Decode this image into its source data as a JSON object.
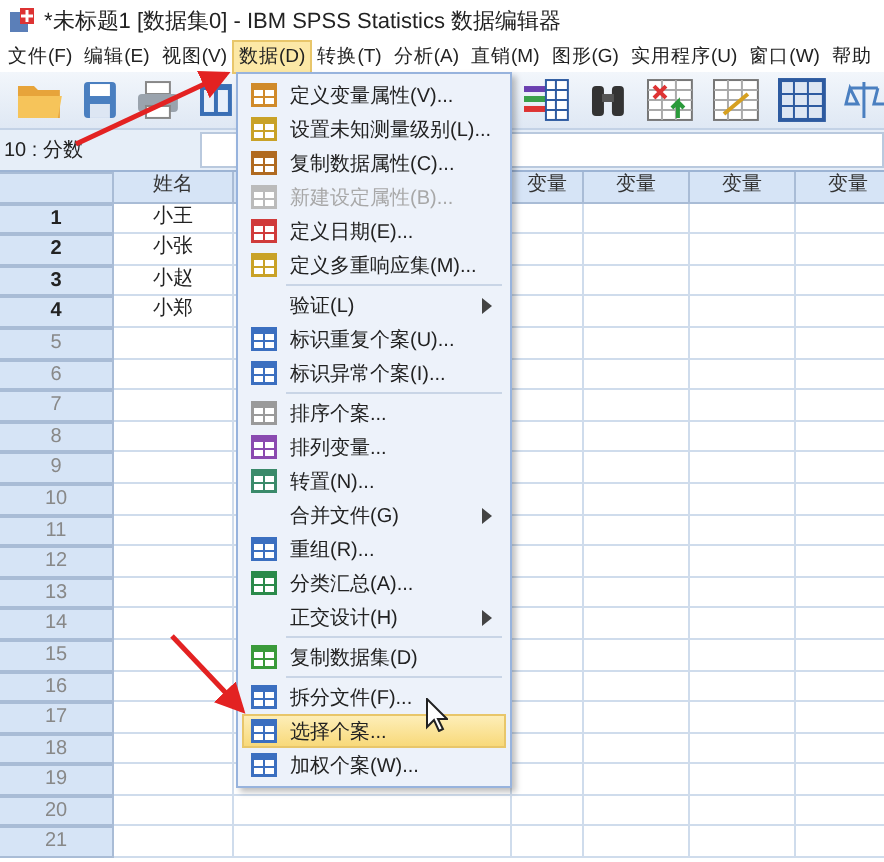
{
  "window": {
    "title": "*未标题1 [数据集0] - IBM SPSS Statistics 数据编辑器"
  },
  "menubar": [
    {
      "label": "文件(F)",
      "selected": false
    },
    {
      "label": "编辑(E)",
      "selected": false
    },
    {
      "label": "视图(V)",
      "selected": false
    },
    {
      "label": "数据(D)",
      "selected": true
    },
    {
      "label": "转换(T)",
      "selected": false
    },
    {
      "label": "分析(A)",
      "selected": false
    },
    {
      "label": "直销(M)",
      "selected": false
    },
    {
      "label": "图形(G)",
      "selected": false
    },
    {
      "label": "实用程序(U)",
      "selected": false
    },
    {
      "label": "窗口(W)",
      "selected": false
    },
    {
      "label": "帮助",
      "selected": false
    }
  ],
  "cell_reference": "10 : 分数",
  "grid": {
    "columns": [
      "姓名",
      "变量",
      "变量",
      "变量",
      "变量"
    ],
    "rows": [
      {
        "number": "1",
        "name": "小王"
      },
      {
        "number": "2",
        "name": "小张"
      },
      {
        "number": "3",
        "name": "小赵"
      },
      {
        "number": "4",
        "name": "小郑"
      },
      {
        "number": "5"
      },
      {
        "number": "6"
      },
      {
        "number": "7"
      },
      {
        "number": "8"
      },
      {
        "number": "9"
      },
      {
        "number": "10"
      },
      {
        "number": "11"
      },
      {
        "number": "12"
      },
      {
        "number": "13"
      },
      {
        "number": "14"
      },
      {
        "number": "15"
      },
      {
        "number": "16"
      },
      {
        "number": "17"
      },
      {
        "number": "18"
      },
      {
        "number": "19"
      },
      {
        "number": "20"
      },
      {
        "number": "21"
      }
    ]
  },
  "data_menu": [
    {
      "kind": "item",
      "label": "定义变量属性(V)...",
      "disabled": false,
      "selected": false
    },
    {
      "kind": "item",
      "label": "设置未知测量级别(L)...",
      "disabled": false,
      "selected": false
    },
    {
      "kind": "item",
      "label": "复制数据属性(C)...",
      "disabled": false,
      "selected": false
    },
    {
      "kind": "item",
      "label": "新建设定属性(B)...",
      "disabled": true,
      "selected": false
    },
    {
      "kind": "item",
      "label": "定义日期(E)...",
      "disabled": false,
      "selected": false
    },
    {
      "kind": "item",
      "label": "定义多重响应集(M)...",
      "disabled": false,
      "selected": false
    },
    {
      "kind": "separator"
    },
    {
      "kind": "submenu",
      "label": "验证(L)",
      "disabled": false,
      "selected": false
    },
    {
      "kind": "item",
      "label": "标识重复个案(U)...",
      "disabled": false,
      "selected": false
    },
    {
      "kind": "item",
      "label": "标识异常个案(I)...",
      "disabled": false,
      "selected": false
    },
    {
      "kind": "separator"
    },
    {
      "kind": "item",
      "label": "排序个案...",
      "disabled": false,
      "selected": false
    },
    {
      "kind": "item",
      "label": "排列变量...",
      "disabled": false,
      "selected": false
    },
    {
      "kind": "item",
      "label": "转置(N)...",
      "disabled": false,
      "selected": false
    },
    {
      "kind": "submenu",
      "label": "合并文件(G)",
      "disabled": false,
      "selected": false
    },
    {
      "kind": "item",
      "label": "重组(R)...",
      "disabled": false,
      "selected": false
    },
    {
      "kind": "item",
      "label": "分类汇总(A)...",
      "disabled": false,
      "selected": false
    },
    {
      "kind": "submenu",
      "label": "正交设计(H)",
      "disabled": false,
      "selected": false
    },
    {
      "kind": "separator"
    },
    {
      "kind": "item",
      "label": "复制数据集(D)",
      "disabled": false,
      "selected": false
    },
    {
      "kind": "separator"
    },
    {
      "kind": "item",
      "label": "拆分文件(F)...",
      "disabled": false,
      "selected": false
    },
    {
      "kind": "item",
      "label": "选择个案...",
      "disabled": false,
      "selected": true
    },
    {
      "kind": "item",
      "label": "加权个案(W)...",
      "disabled": false,
      "selected": false
    }
  ]
}
